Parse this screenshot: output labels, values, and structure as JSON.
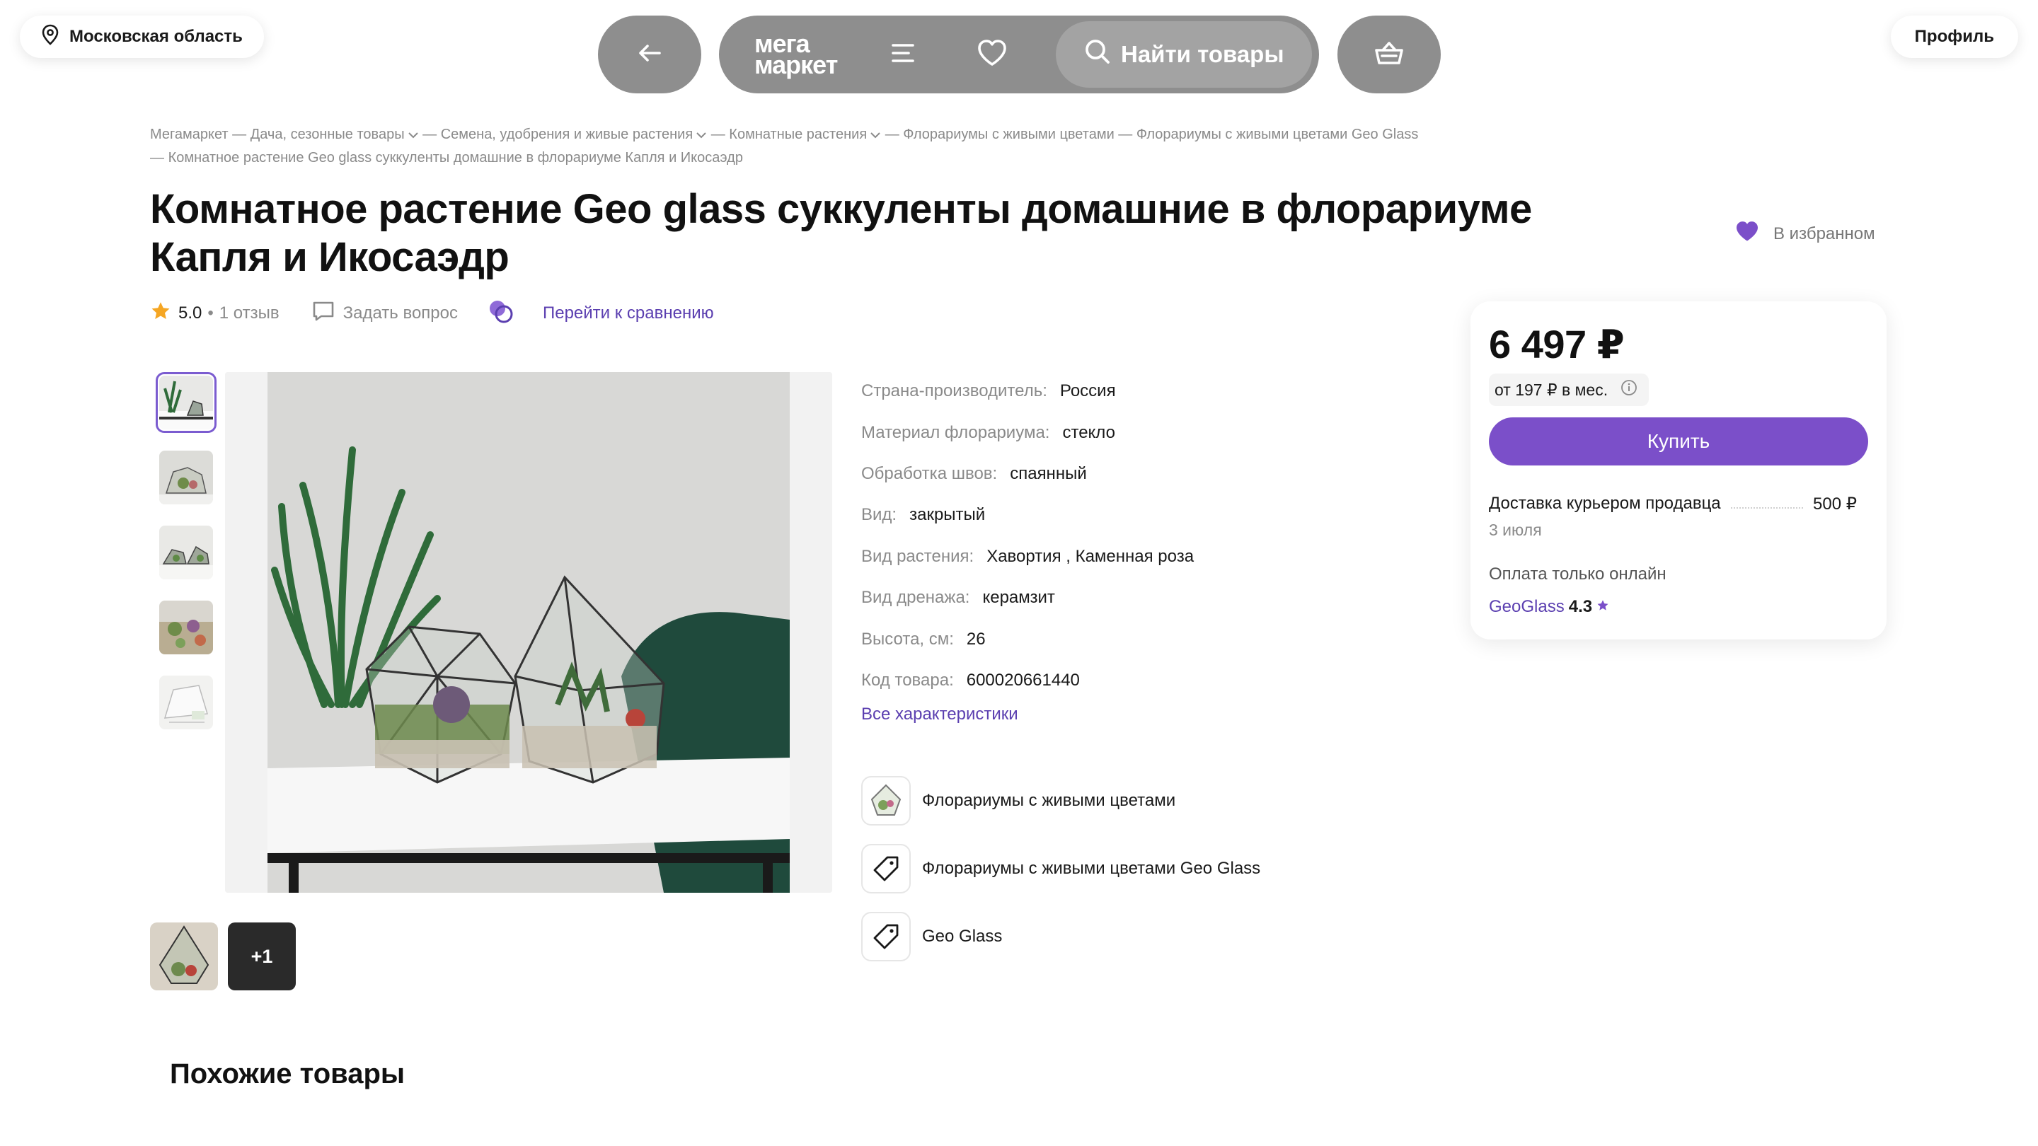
{
  "header": {
    "region": "Московская область",
    "profile": "Профиль",
    "logo_line1": "мега",
    "logo_line2": "маркет",
    "search_label": "Найти товары"
  },
  "breadcrumbs": [
    "Мегамаркет",
    "Дача, сезонные товары",
    "Семена, удобрения и живые растения",
    "Комнатные растения",
    "Флорариумы с живыми цветами",
    "Флорариумы с живыми цветами Geo Glass",
    "Комнатное растение Geo glass суккуленты домашние в флорариуме Капля и Икосаэдр"
  ],
  "product": {
    "title": "Комнатное растение Geo glass суккуленты домашние в флорариуме Капля и Икосаэдр",
    "favorite_label": "В избранном",
    "rating": "5.0",
    "reviews": "1 отзыв",
    "ask_question": "Задать вопрос",
    "compare": "Перейти к сравнению",
    "more_images": "+1"
  },
  "specs": [
    {
      "label": "Страна-производитель:",
      "value": "Россия"
    },
    {
      "label": "Материал флорариума:",
      "value": "стекло"
    },
    {
      "label": "Обработка швов:",
      "value": "спаянный"
    },
    {
      "label": "Вид:",
      "value": "закрытый"
    },
    {
      "label": "Вид растения:",
      "value": "Хавортия , Каменная роза"
    },
    {
      "label": "Вид дренажа:",
      "value": "керамзит"
    },
    {
      "label": "Высота, см:",
      "value": "26"
    },
    {
      "label": "Код товара:",
      "value": "600020661440"
    }
  ],
  "all_specs": "Все характеристики",
  "category_links": [
    {
      "label": "Флорариумы с живыми цветами",
      "icon": "florarium-thumb-icon"
    },
    {
      "label": "Флорариумы с живыми цветами Geo Glass",
      "icon": "tag-icon"
    },
    {
      "label": "Geo Glass",
      "icon": "tag-icon"
    }
  ],
  "buy_card": {
    "price": "6 497 ₽",
    "installment": "от 197 ₽ в мес.",
    "buy_button": "Купить",
    "delivery_label": "Доставка курьером продавца",
    "delivery_price": "500 ₽",
    "delivery_date": "3 июля",
    "payment": "Оплата только онлайн",
    "seller": "GeoGlass",
    "seller_rating": "4.3"
  },
  "similar_title": "Похожие товары",
  "colors": {
    "accent": "#7b4fc9",
    "link": "#5b3fb0",
    "star": "#f5a623",
    "nav_bg": "#8e8e8e"
  }
}
